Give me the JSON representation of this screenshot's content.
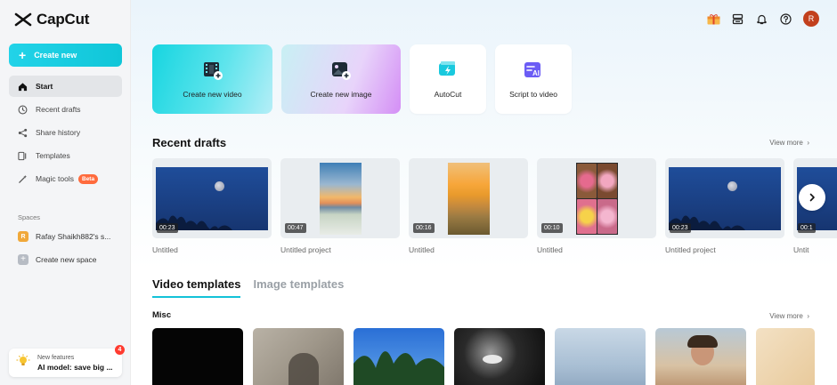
{
  "app": {
    "name": "CapCut"
  },
  "sidebar": {
    "create_label": "Create new",
    "nav": [
      {
        "label": "Start",
        "icon": "home-icon",
        "active": true
      },
      {
        "label": "Recent drafts",
        "icon": "clock-icon"
      },
      {
        "label": "Share history",
        "icon": "share-icon"
      },
      {
        "label": "Templates",
        "icon": "templates-icon"
      },
      {
        "label": "Magic tools",
        "icon": "magic-wand-icon",
        "badge": "Beta"
      }
    ],
    "spaces_label": "Spaces",
    "space_name": "Rafay Shaikh882's s...",
    "space_initial": "R",
    "create_space_label": "Create new space",
    "feature": {
      "line1": "New features",
      "line2": "AI model: save big ...",
      "count": "4"
    }
  },
  "topbar": {
    "user_initial": "R"
  },
  "actions": [
    {
      "label": "Create new video",
      "icon": "video-add-icon"
    },
    {
      "label": "Create new image",
      "icon": "image-add-icon"
    },
    {
      "label": "AutoCut",
      "icon": "autocut-icon"
    },
    {
      "label": "Script to video",
      "icon": "script-ai-icon"
    }
  ],
  "recent_drafts": {
    "title": "Recent drafts",
    "view_more": "View more",
    "items": [
      {
        "label": "Untitled",
        "duration": "00:23"
      },
      {
        "label": "Untitled project",
        "duration": "00:47"
      },
      {
        "label": "Untitled",
        "duration": "00:16"
      },
      {
        "label": "Untitled",
        "duration": "00:10"
      },
      {
        "label": "Untitled project",
        "duration": "00:23"
      },
      {
        "label": "Untit",
        "duration": "00:1"
      }
    ]
  },
  "template_tabs": [
    {
      "label": "Video templates",
      "active": true
    },
    {
      "label": "Image templates",
      "active": false
    }
  ],
  "misc": {
    "title": "Misc",
    "view_more": "View more"
  },
  "colors": {
    "accent": "#13c2d8",
    "beta": "#ff6b3d",
    "avatar": "#c2401d"
  }
}
